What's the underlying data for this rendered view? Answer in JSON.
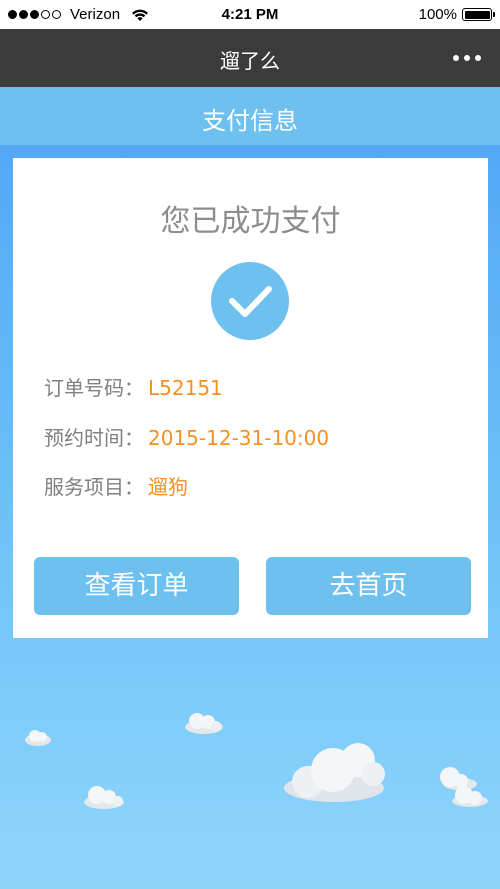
{
  "status_bar": {
    "carrier": "Verizon",
    "time": "4:21 PM",
    "battery": "100%",
    "signal_bars_filled": 3,
    "signal_bars_total": 5
  },
  "nav": {
    "title": "遛了么",
    "more_icon": "more-dots-icon"
  },
  "header": {
    "title": "支付信息"
  },
  "card": {
    "success_title": "您已成功支付",
    "check_icon": "checkmark-icon",
    "rows": [
      {
        "label": "订单号码：",
        "value": "L52151"
      },
      {
        "label": "预约时间：",
        "value": "2015-12-31-10:00"
      },
      {
        "label": "服务项目：",
        "value": "遛狗"
      }
    ],
    "buttons": {
      "view_order": "查看订单",
      "home": "去首页"
    }
  },
  "colors": {
    "accent": "#6ec0ee",
    "value_orange": "#f39222",
    "nav_dark": "#3b3b3b",
    "label_gray": "#808080"
  }
}
